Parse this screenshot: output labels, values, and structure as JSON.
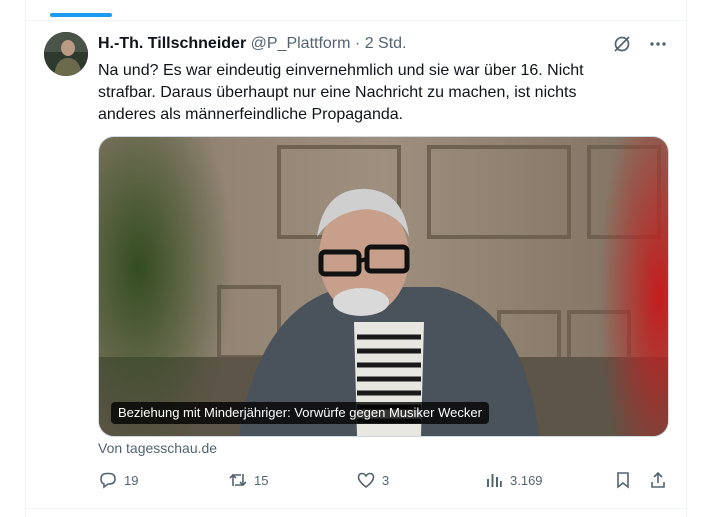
{
  "author": {
    "display_name": "H.-Th. Tillschneider",
    "handle": "@P_Plattform",
    "time": "2 Std."
  },
  "tweet": {
    "text": "Na und? Es war eindeutig einvernehmlich und sie war über 16. Nicht strafbar. Daraus überhaupt nur eine Nachricht zu machen, ist nichts anderes als männerfeindliche Propaganda."
  },
  "card": {
    "title": "Beziehung mit Minderjähriger: Vorwürfe gegen Musiker Wecker",
    "source": "Von tagesschau.de"
  },
  "actions": {
    "replies": "19",
    "retweets": "15",
    "likes": "3",
    "views": "3.169"
  },
  "icons": {
    "header": [
      "grok-icon",
      "more-icon"
    ],
    "actions": [
      "reply-icon",
      "retweet-icon",
      "like-icon",
      "views-icon",
      "bookmark-icon",
      "share-icon"
    ]
  },
  "colors": {
    "accent": "#1d9bf0",
    "text": "#0f1419",
    "muted": "#536471",
    "border": "#eff3f4"
  }
}
